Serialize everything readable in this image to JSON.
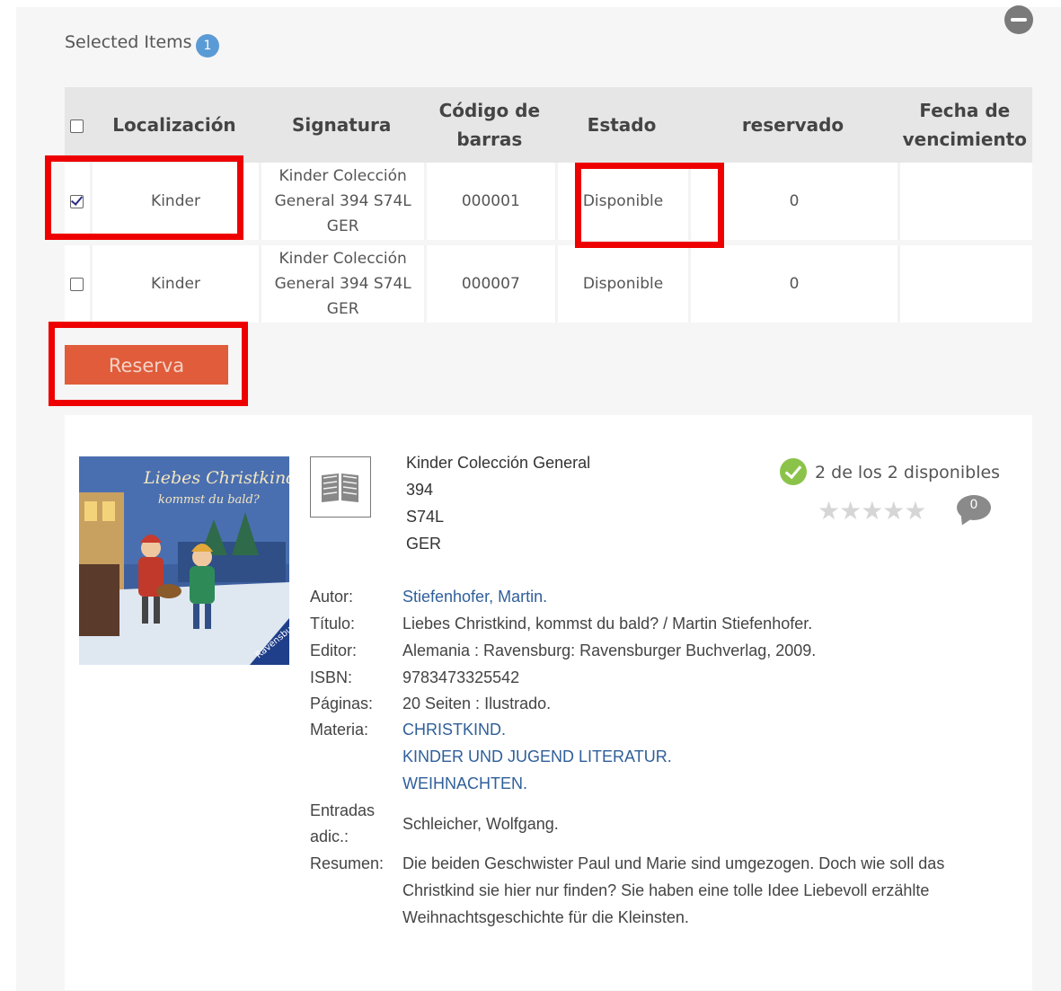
{
  "selected": {
    "title": "Selected Items",
    "count": "1"
  },
  "table": {
    "headers": {
      "localizacion": "Localización",
      "signatura": "Signatura",
      "codigo1": "Código de",
      "codigo2": "barras",
      "estado": "Estado",
      "reservado": "reservado",
      "fecha1": "Fecha de",
      "fecha2": "vencimiento"
    },
    "rows": [
      {
        "checked": true,
        "localizacion": "Kinder",
        "sig1": "Kinder Colección",
        "sig2": "General 394 S74L",
        "sig3": "GER",
        "codigo": "000001",
        "estado": "Disponible",
        "reservado": "0",
        "fecha": ""
      },
      {
        "checked": false,
        "localizacion": "Kinder",
        "sig1": "Kinder Colección",
        "sig2": "General 394 S74L",
        "sig3": "GER",
        "codigo": "000007",
        "estado": "Disponible",
        "reservado": "0",
        "fecha": ""
      }
    ]
  },
  "reserve_button": "Reserva",
  "record": {
    "cover_title1": "Liebes Christkind,",
    "cover_title2": "kommst du bald?",
    "format_icon": "book-icon",
    "call_number": [
      "Kinder Colección General",
      "394",
      "S74L",
      "GER"
    ],
    "availability": "2 de los 2 disponibles",
    "rating": "★★★★★",
    "comments": "0",
    "fields": {
      "autor_label": "Autor:",
      "autor": "Stiefenhofer, Martin.",
      "titulo_label": "Título:",
      "titulo": "Liebes Christkind, kommst du bald? / Martin Stiefenhofer.",
      "editor_label": "Editor:",
      "editor": "Alemania : Ravensburg: Ravensburger Buchverlag, 2009.",
      "isbn_label": "ISBN:",
      "isbn": "9783473325542",
      "paginas_label": "Páginas:",
      "paginas": "20 Seiten : Ilustrado.",
      "materia_label": "Materia:",
      "materia": [
        "CHRISTKIND.",
        "KINDER UND JUGEND LITERATUR.",
        "WEIHNACHTEN."
      ],
      "entradas_label1": "Entradas",
      "entradas_label2": "adic.:",
      "entradas": "Schleicher, Wolfgang.",
      "resumen_label": "Resumen:",
      "resumen": [
        "Die beiden Geschwister Paul und Marie sind umgezogen. Doch wie soll das",
        "Christkind sie hier nur finden? Sie haben eine tolle Idee Liebevoll erzählte",
        "Weihnachtsgeschichte für die Kleinsten."
      ]
    }
  },
  "colors": {
    "highlight": "#ee0000",
    "button": "#e05c3a",
    "link": "#2f5f9a",
    "badge": "#5b9bd5",
    "available": "#8bc34a"
  }
}
